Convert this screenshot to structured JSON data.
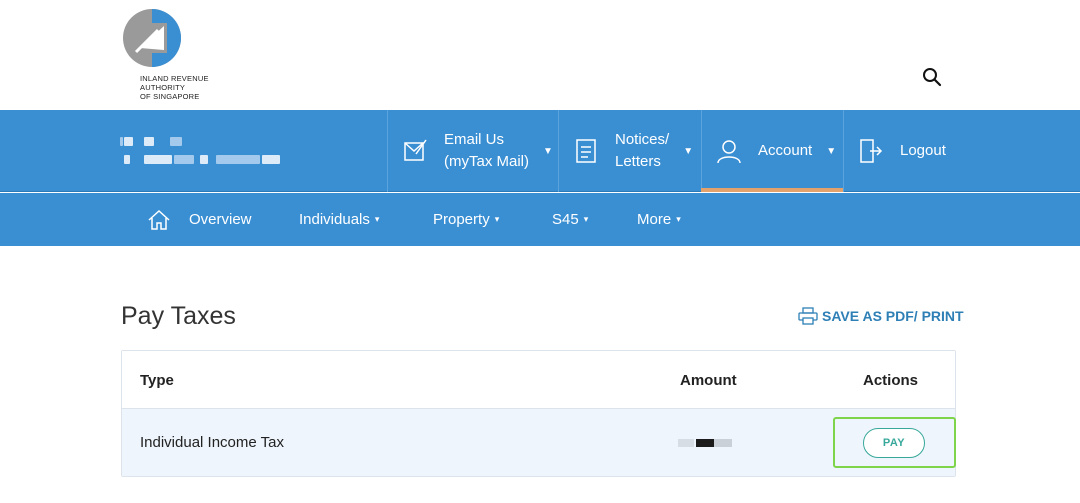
{
  "logo": {
    "alt_lines": [
      "INLAND REVENUE",
      "AUTHORITY",
      "OF SINGAPORE"
    ]
  },
  "header": {
    "search_icon": "search-icon"
  },
  "main_nav": {
    "email": {
      "label_line1": "Email Us",
      "label_line2": "(myTax Mail)",
      "icon": "envelope-icon"
    },
    "notices": {
      "label_line1": "Notices/",
      "label_line2": "Letters",
      "icon": "document-icon"
    },
    "account": {
      "label": "Account",
      "icon": "user-icon"
    },
    "logout": {
      "label": "Logout",
      "icon": "door-exit-icon"
    },
    "caret": "▼"
  },
  "sub_nav": {
    "overview": "Overview",
    "individuals": "Individuals",
    "property": "Property",
    "s45": "S45",
    "more": "More",
    "caret": "▾"
  },
  "page": {
    "title": "Pay Taxes",
    "save_print": "SAVE AS PDF/ PRINT"
  },
  "table": {
    "headers": {
      "type": "Type",
      "amount": "Amount",
      "actions": "Actions"
    },
    "rows": [
      {
        "type": "Individual Income Tax",
        "action": "PAY"
      }
    ]
  },
  "colors": {
    "nav_blue": "#3a8fd3",
    "account_underline": "#e3a26b",
    "pay_teal": "#37a89a",
    "highlight_green": "#7ed44a",
    "link_blue": "#2d7fb6"
  }
}
